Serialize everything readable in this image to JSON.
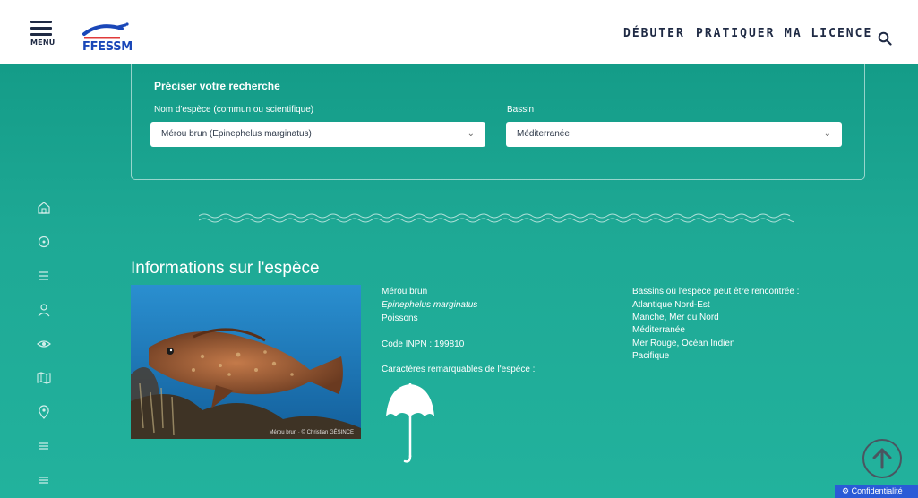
{
  "header": {
    "menu_label": "MENU",
    "logo_text": "FFESSM",
    "nav": [
      "DÉBUTER",
      "PRATIQUER",
      "MA LICENCE"
    ]
  },
  "search": {
    "title": "Préciser votre recherche",
    "species_label": "Nom d'espèce (commun ou scientifique)",
    "species_value": "Mérou brun (Epinephelus marginatus)",
    "basin_label": "Bassin",
    "basin_value": "Méditerranée"
  },
  "side_icons": [
    "home-icon",
    "compass-icon",
    "list-icon",
    "person-icon",
    "eye-icon",
    "map-icon",
    "location-pin-icon",
    "list-icon",
    "list-icon"
  ],
  "species": {
    "section_title": "Informations sur l'espèce",
    "common_name": "Mérou brun",
    "scientific_name": "Epinephelus marginatus",
    "group": "Poissons",
    "inpn_code": "Code INPN : 199810",
    "remarkable_label": "Caractères remarquables de l'espèce :",
    "photo_credit": "Mérou brun · © Christian GÉSINCE",
    "basins_label": "Bassins où l'espèce peut être rencontrée :",
    "basins": [
      "Atlantique Nord-Est",
      "Manche, Mer du Nord",
      "Méditerranée",
      "Mer Rouge, Océan Indien",
      "Pacifique"
    ]
  },
  "footer": {
    "confidentiality": "Confidentialité"
  },
  "colors": {
    "teal": "#1ea995",
    "navy": "#1f2a44",
    "logo_blue": "#1a47b8",
    "badge_blue": "#2a5bd7"
  }
}
